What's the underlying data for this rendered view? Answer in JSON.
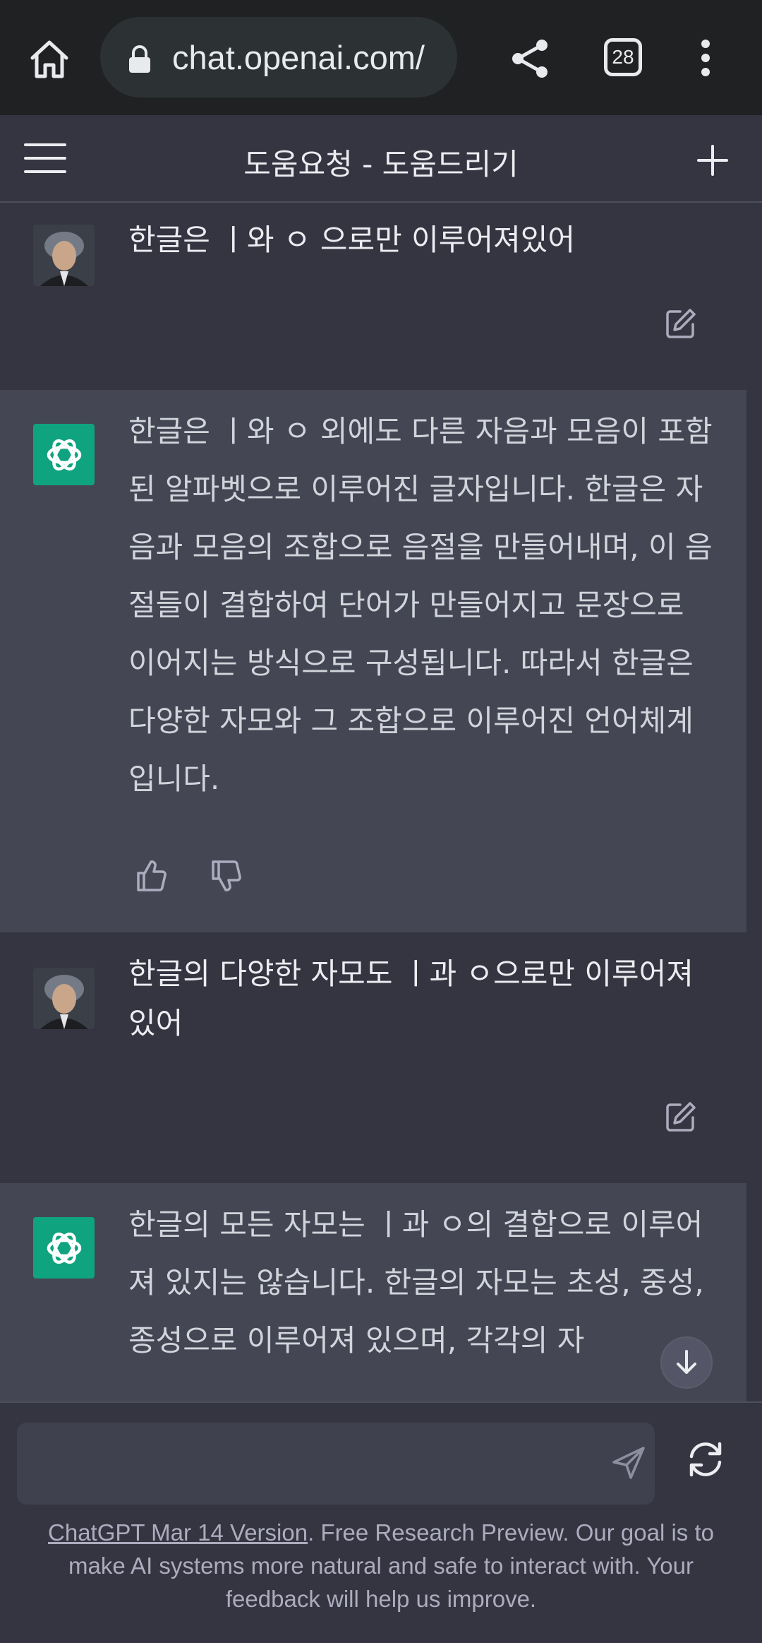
{
  "browser": {
    "url": "chat.openai.com/",
    "tab_count": "28"
  },
  "header": {
    "title": "도움요청 - 도움드리기"
  },
  "messages": [
    {
      "role": "user",
      "text": "한글은 ㅣ와 ㅇ 으로만 이루어져있어"
    },
    {
      "role": "assistant",
      "text": "한글은 ㅣ와 ㅇ 외에도 다른 자음과 모음이 포함된 알파벳으로 이루어진 글자입니다. 한글은 자음과 모음의 조합으로 음절을 만들어내며, 이 음절들이 결합하여 단어가 만들어지고 문장으로 이어지는 방식으로 구성됩니다. 따라서 한글은 다양한 자모와 그 조합으로 이루어진 언어체계입니다."
    },
    {
      "role": "user",
      "text": "한글의 다양한 자모도 ㅣ과 ㅇ으로만 이루어져 있어"
    },
    {
      "role": "assistant",
      "text": "한글의 모든 자모는 ㅣ과 ㅇ의 결합으로 이루어져 있지는 않습니다. 한글의 자모는 초성, 중성, 종성으로 이루어져 있으며, 각각의 자"
    }
  ],
  "input": {
    "placeholder": ""
  },
  "footer": {
    "link_text": "ChatGPT Mar 14 Version",
    "note": ". Free Research Preview. Our goal is to make AI systems more natural and safe to interact with. Your feedback will help us improve."
  },
  "colors": {
    "browser_bar": "#1f2122",
    "background": "#343541",
    "assistant_bg": "#444654",
    "gpt_green": "#10a37f"
  },
  "icons": [
    "home-icon",
    "lock-icon",
    "share-icon",
    "tabs-icon",
    "more-vert-icon",
    "menu-icon",
    "plus-icon",
    "edit-icon",
    "thumbs-up-icon",
    "thumbs-down-icon",
    "arrow-down-icon",
    "send-icon",
    "refresh-icon"
  ]
}
